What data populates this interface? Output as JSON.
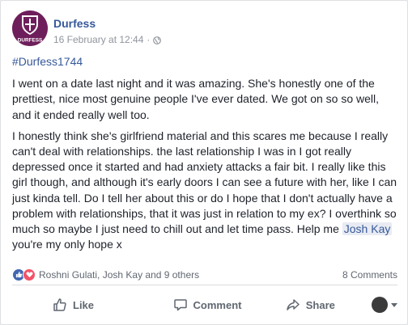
{
  "post": {
    "page_name": "Durfess",
    "timestamp": "16 February at 12:44",
    "separator": "·",
    "avatar_label": "DURFESS",
    "hashtag": "#Durfess1744",
    "paragraph1": "I went on a date last night and it was amazing. She's honestly one of the prettiest, nice most genuine people I've ever dated. We got on so so well, and it ended really well too.",
    "paragraph2_before": "I honestly think she's girlfriend material and this scares me because I really can't deal with relationships. the last relationship I was in I got really depressed once it started and had anxiety attacks a fair bit. I really like this girl though, and although it's early doors I can see a future with her, like I can just kinda tell. Do I tell her about this or do I hope that I don't actually have a problem with relationships, that it was just in relation to my ex? I overthink so much so maybe I just need to chill out and let time pass. Help me ",
    "mention": "Josh Kay",
    "paragraph2_after": " you're my only hope x"
  },
  "reactions": {
    "summary": "Roshni Gulati, Josh Kay and 9 others",
    "comments": "8 Comments",
    "icons": [
      "like-icon",
      "love-icon"
    ]
  },
  "actions": {
    "like": "Like",
    "comment": "Comment",
    "share": "Share"
  },
  "colors": {
    "link": "#365899",
    "text": "#1d2129",
    "meta": "#90949c",
    "like_blue": "#4267b2",
    "love_red": "#f25268",
    "avatar_purple": "#6e1f5b"
  }
}
